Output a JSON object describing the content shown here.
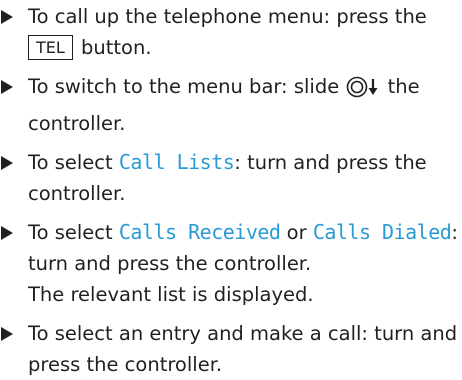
{
  "steps": [
    {
      "pre": "To call up the telephone menu: press the",
      "key": "TEL",
      "post": " button."
    },
    {
      "pre": "To switch to the menu bar: slide",
      "post": " the controller."
    },
    {
      "pre": "To select ",
      "code": "Call Lists",
      "post": ": turn and press the controller."
    },
    {
      "pre": "To select ",
      "code1": "Calls Received",
      "mid": " or ",
      "code2": "Calls Dialed",
      "post": ": turn and press the controller.",
      "extra": "The relevant list is displayed."
    },
    {
      "pre": "To select an entry and make a call: turn and press the controller."
    }
  ],
  "icons": {
    "controller": "controller-slide-down-icon",
    "bullet": "triangle-bullet-icon"
  }
}
